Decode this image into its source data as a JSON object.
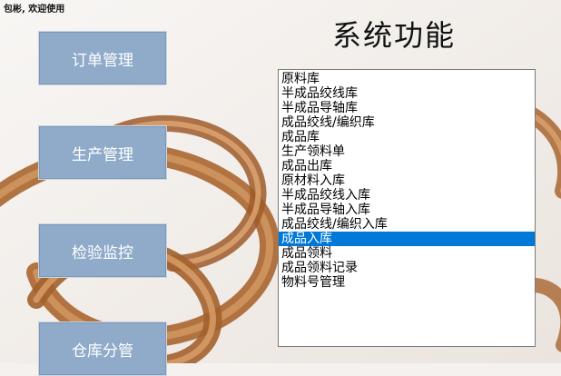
{
  "window": {
    "welcome_text": "包彬, 欢迎使用",
    "title": "系统功能"
  },
  "nav": {
    "items": [
      {
        "label": "订单管理"
      },
      {
        "label": "生产管理"
      },
      {
        "label": "检验监控"
      },
      {
        "label": "仓库分管"
      }
    ]
  },
  "function_list": {
    "selected_index": 11,
    "items": [
      "原料库",
      "半成品绞线库",
      "半成品导轴库",
      "成品绞线/编织库",
      "成品库",
      "生产领料单",
      "成品出库",
      "原材料入库",
      "半成品绞线入库",
      "半成品导轴入库",
      "成品绞线/编织入库",
      "成品入库",
      "成品领料",
      "成品领料记录",
      "物料号管理"
    ]
  },
  "colors": {
    "nav_button_bg": "#8fabc9",
    "selection": "#0078d7",
    "copper": "#b5743f"
  }
}
